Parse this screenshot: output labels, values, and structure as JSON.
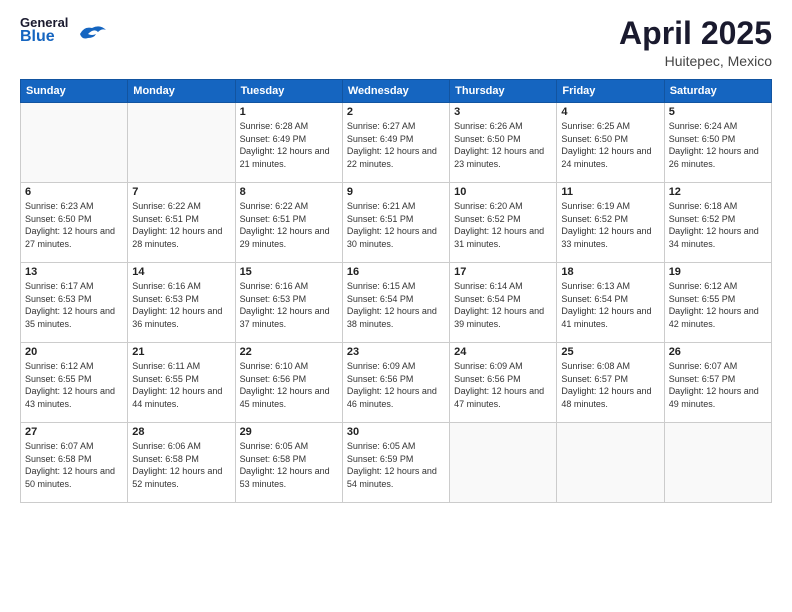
{
  "header": {
    "logo_general": "General",
    "logo_blue": "Blue",
    "main_title": "April 2025",
    "subtitle": "Huitepec, Mexico"
  },
  "days_of_week": [
    "Sunday",
    "Monday",
    "Tuesday",
    "Wednesday",
    "Thursday",
    "Friday",
    "Saturday"
  ],
  "weeks": [
    [
      {
        "day": "",
        "info": ""
      },
      {
        "day": "",
        "info": ""
      },
      {
        "day": "1",
        "sunrise": "6:28 AM",
        "sunset": "6:49 PM",
        "daylight": "12 hours and 21 minutes."
      },
      {
        "day": "2",
        "sunrise": "6:27 AM",
        "sunset": "6:49 PM",
        "daylight": "12 hours and 22 minutes."
      },
      {
        "day": "3",
        "sunrise": "6:26 AM",
        "sunset": "6:50 PM",
        "daylight": "12 hours and 23 minutes."
      },
      {
        "day": "4",
        "sunrise": "6:25 AM",
        "sunset": "6:50 PM",
        "daylight": "12 hours and 24 minutes."
      },
      {
        "day": "5",
        "sunrise": "6:24 AM",
        "sunset": "6:50 PM",
        "daylight": "12 hours and 26 minutes."
      }
    ],
    [
      {
        "day": "6",
        "sunrise": "6:23 AM",
        "sunset": "6:50 PM",
        "daylight": "12 hours and 27 minutes."
      },
      {
        "day": "7",
        "sunrise": "6:22 AM",
        "sunset": "6:51 PM",
        "daylight": "12 hours and 28 minutes."
      },
      {
        "day": "8",
        "sunrise": "6:22 AM",
        "sunset": "6:51 PM",
        "daylight": "12 hours and 29 minutes."
      },
      {
        "day": "9",
        "sunrise": "6:21 AM",
        "sunset": "6:51 PM",
        "daylight": "12 hours and 30 minutes."
      },
      {
        "day": "10",
        "sunrise": "6:20 AM",
        "sunset": "6:52 PM",
        "daylight": "12 hours and 31 minutes."
      },
      {
        "day": "11",
        "sunrise": "6:19 AM",
        "sunset": "6:52 PM",
        "daylight": "12 hours and 33 minutes."
      },
      {
        "day": "12",
        "sunrise": "6:18 AM",
        "sunset": "6:52 PM",
        "daylight": "12 hours and 34 minutes."
      }
    ],
    [
      {
        "day": "13",
        "sunrise": "6:17 AM",
        "sunset": "6:53 PM",
        "daylight": "12 hours and 35 minutes."
      },
      {
        "day": "14",
        "sunrise": "6:16 AM",
        "sunset": "6:53 PM",
        "daylight": "12 hours and 36 minutes."
      },
      {
        "day": "15",
        "sunrise": "6:16 AM",
        "sunset": "6:53 PM",
        "daylight": "12 hours and 37 minutes."
      },
      {
        "day": "16",
        "sunrise": "6:15 AM",
        "sunset": "6:54 PM",
        "daylight": "12 hours and 38 minutes."
      },
      {
        "day": "17",
        "sunrise": "6:14 AM",
        "sunset": "6:54 PM",
        "daylight": "12 hours and 39 minutes."
      },
      {
        "day": "18",
        "sunrise": "6:13 AM",
        "sunset": "6:54 PM",
        "daylight": "12 hours and 41 minutes."
      },
      {
        "day": "19",
        "sunrise": "6:12 AM",
        "sunset": "6:55 PM",
        "daylight": "12 hours and 42 minutes."
      }
    ],
    [
      {
        "day": "20",
        "sunrise": "6:12 AM",
        "sunset": "6:55 PM",
        "daylight": "12 hours and 43 minutes."
      },
      {
        "day": "21",
        "sunrise": "6:11 AM",
        "sunset": "6:55 PM",
        "daylight": "12 hours and 44 minutes."
      },
      {
        "day": "22",
        "sunrise": "6:10 AM",
        "sunset": "6:56 PM",
        "daylight": "12 hours and 45 minutes."
      },
      {
        "day": "23",
        "sunrise": "6:09 AM",
        "sunset": "6:56 PM",
        "daylight": "12 hours and 46 minutes."
      },
      {
        "day": "24",
        "sunrise": "6:09 AM",
        "sunset": "6:56 PM",
        "daylight": "12 hours and 47 minutes."
      },
      {
        "day": "25",
        "sunrise": "6:08 AM",
        "sunset": "6:57 PM",
        "daylight": "12 hours and 48 minutes."
      },
      {
        "day": "26",
        "sunrise": "6:07 AM",
        "sunset": "6:57 PM",
        "daylight": "12 hours and 49 minutes."
      }
    ],
    [
      {
        "day": "27",
        "sunrise": "6:07 AM",
        "sunset": "6:58 PM",
        "daylight": "12 hours and 50 minutes."
      },
      {
        "day": "28",
        "sunrise": "6:06 AM",
        "sunset": "6:58 PM",
        "daylight": "12 hours and 52 minutes."
      },
      {
        "day": "29",
        "sunrise": "6:05 AM",
        "sunset": "6:58 PM",
        "daylight": "12 hours and 53 minutes."
      },
      {
        "day": "30",
        "sunrise": "6:05 AM",
        "sunset": "6:59 PM",
        "daylight": "12 hours and 54 minutes."
      },
      {
        "day": "",
        "info": ""
      },
      {
        "day": "",
        "info": ""
      },
      {
        "day": "",
        "info": ""
      }
    ]
  ],
  "labels": {
    "sunrise_label": "Sunrise:",
    "sunset_label": "Sunset:",
    "daylight_label": "Daylight:"
  }
}
